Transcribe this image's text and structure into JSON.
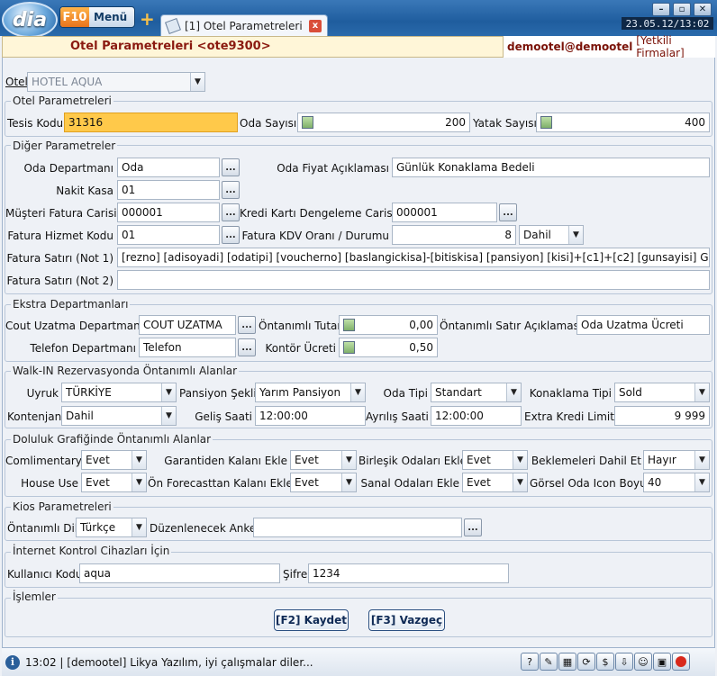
{
  "app": {
    "logo": "dia",
    "f10_key": "F10",
    "menu_label": "Menü",
    "clock": "23.05.12/13:02"
  },
  "tab": {
    "label": "[1] Otel Parametreleri",
    "close": "x"
  },
  "header": {
    "form_title": "Otel Parametreleri <ote9300>",
    "user": "demootel@demootel",
    "company": "[Yetkili Firmalar]"
  },
  "otel": {
    "label": "Otel",
    "value": "HOTEL AQUA"
  },
  "otel_parametreleri": {
    "legend": "Otel Parametreleri",
    "tesis_kodu_label": "Tesis Kodu",
    "tesis_kodu": "31316",
    "oda_sayisi_label": "Oda Sayısı",
    "oda_sayisi": "200",
    "yatak_sayisi_label": "Yatak Sayısı",
    "yatak_sayisi": "400"
  },
  "diger": {
    "legend": "Diğer Parametreler",
    "oda_departmani_label": "Oda Departmanı",
    "oda_departmani": "Oda",
    "oda_fiyat_label": "Oda Fiyat Açıklaması",
    "oda_fiyat": "Günlük Konaklama Bedeli",
    "nakit_kasa_label": "Nakit Kasa",
    "nakit_kasa": "01",
    "musteri_fatura_label": "Müşteri Fatura Carisi",
    "musteri_fatura": "000001",
    "kredi_karti_label": "Kredi Kartı Dengeleme Carisi",
    "kredi_karti": "000001",
    "fatura_hizmet_label": "Fatura Hizmet Kodu",
    "fatura_hizmet": "01",
    "fatura_kdv_label": "Fatura KDV Oranı / Durumu",
    "fatura_kdv": "8",
    "fatura_kdv_durum": "Dahil",
    "not1_label": "Fatura Satırı (Not 1)",
    "not1": "[rezno] [adisoyadi] [odatipi] [voucherno] [baslangickisa]-[bitiskisa] [pansiyon] [kisi]+[c1]+[c2] [gunsayisi] Gün x [",
    "not2_label": "Fatura Satırı (Not 2)",
    "not2": ""
  },
  "ekstra": {
    "legend": "Ekstra Departmanları",
    "cout_label": "Cout Uzatma Departmanı",
    "cout": "COUT UZATMA",
    "tutar_label": "Öntanımlı Tutar",
    "tutar": "0,00",
    "satir_label": "Öntanımlı Satır Açıklaması",
    "satir": "Oda Uzatma Ücreti",
    "telefon_label": "Telefon Departmanı",
    "telefon": "Telefon",
    "kontor_label": "Kontör Ücreti",
    "kontor": "0,50"
  },
  "walkin": {
    "legend": "Walk-IN Rezervasyonda Öntanımlı Alanlar",
    "uyruk_label": "Uyruk",
    "uyruk": "TÜRKİYE",
    "pansiyon_label": "Pansiyon Şekli",
    "pansiyon": "Yarım Pansiyon",
    "oda_tipi_label": "Oda Tipi",
    "oda_tipi": "Standart",
    "konaklama_label": "Konaklama Tipi",
    "konaklama": "Sold",
    "kontenjan_label": "Kontenjan",
    "kontenjan": "Dahil",
    "gelis_label": "Geliş Saati",
    "gelis": "12:00:00",
    "ayrilis_label": "Ayrılış Saati",
    "ayrilis": "12:00:00",
    "kredi_label": "Extra Kredi Limiti",
    "kredi": "9 999"
  },
  "doluluk": {
    "legend": "Doluluk Grafiğinde Öntanımlı Alanlar",
    "comlimentary_label": "Comlimentary",
    "comlimentary": "Evet",
    "garantiden_label": "Garantiden Kalanı Ekle",
    "garantiden": "Evet",
    "birlesik_label": "Birleşik Odaları Ekle",
    "birlesik": "Evet",
    "beklemeleri_label": "Beklemeleri Dahil Et",
    "beklemeleri": "Hayır",
    "house_label": "House Use",
    "house": "Evet",
    "forecast_label": "Ön Forecasttan Kalanı Ekle",
    "forecast": "Evet",
    "sanal_label": "Sanal Odaları Ekle",
    "sanal": "Evet",
    "icon_boyu_label": "Görsel Oda Icon Boyu",
    "icon_boyu": "40"
  },
  "kios": {
    "legend": "Kios Parametreleri",
    "dil_label": "Öntanımlı Dil",
    "dil": "Türkçe",
    "anket_label": "Düzenlenecek Anket",
    "anket": ""
  },
  "internet": {
    "legend": "İnternet Kontrol Cihazları İçin",
    "kullanici_label": "Kullanıcı Kodu",
    "kullanici": "aqua",
    "sifre_label": "Şifre",
    "sifre": "1234"
  },
  "islemler": {
    "legend": "İşlemler",
    "kaydet": "[F2] Kaydet",
    "vazgec": "[F3] Vazgeç"
  },
  "status": {
    "time": "13:02",
    "message": "| [demootel] Likya Yazılım, iyi çalışmalar diler..."
  },
  "ellipsis": "...",
  "colors": {
    "accent": "#1f5d9e",
    "highlight": "#ffc94a",
    "title": "#8a1a10"
  }
}
